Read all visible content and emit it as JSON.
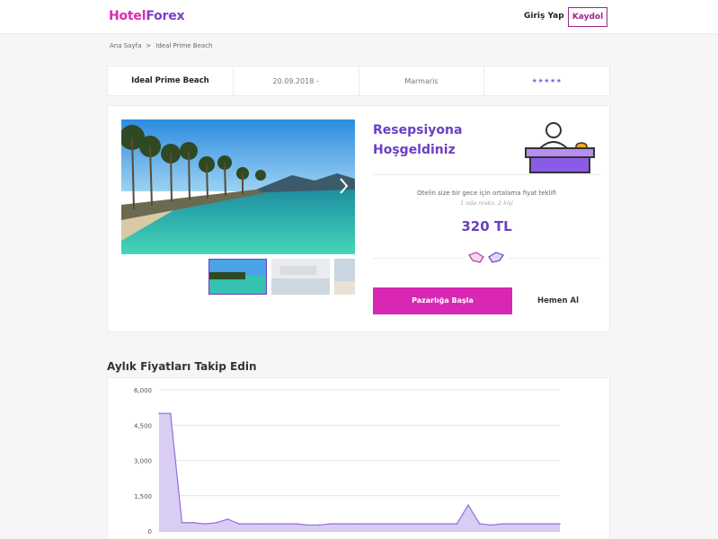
{
  "header": {
    "logo_part1": "Hotel",
    "logo_part2": "Forex",
    "login_label": "Giriş Yap",
    "signup_label": "Kaydol"
  },
  "breadcrumb": {
    "home": "Ana Sayfa",
    "separator": ">",
    "current": "Ideal Prime Beach"
  },
  "info": {
    "hotel_name": "Ideal Prime Beach",
    "date": "20.09.2018 -",
    "location": "Marmaris",
    "stars": "★★★★★"
  },
  "offer": {
    "welcome_line1": "Resepsiyona",
    "welcome_line2": "Hoşgeldiniz",
    "avg_text": "Otelin size bir gece için ortalama fiyat teklifi",
    "guests_text": "1 oda maks. 2 kişi",
    "price": "320 TL",
    "negotiate_label": "Pazarlığa Başla",
    "buy_label": "Hemen Al"
  },
  "colors": {
    "brand_pink": "#d827b4",
    "brand_purple": "#6a3fc3",
    "chart_fill": "#d9cdf3",
    "chart_line": "#8f6fdc"
  },
  "section_title": "Aylık Fiyatları Takip Edin",
  "chart_data": {
    "type": "area",
    "ylim": [
      0,
      6000
    ],
    "yticks": [
      "0",
      "1,500",
      "3,000",
      "4,500",
      "6,000"
    ],
    "grid": true,
    "values": [
      5000,
      5000,
      350,
      350,
      300,
      350,
      500,
      300,
      300,
      300,
      300,
      300,
      300,
      250,
      250,
      300,
      300,
      300,
      300,
      300,
      300,
      300,
      300,
      300,
      300,
      300,
      300,
      1100,
      300,
      250,
      300,
      300,
      300,
      300,
      300,
      300
    ]
  }
}
